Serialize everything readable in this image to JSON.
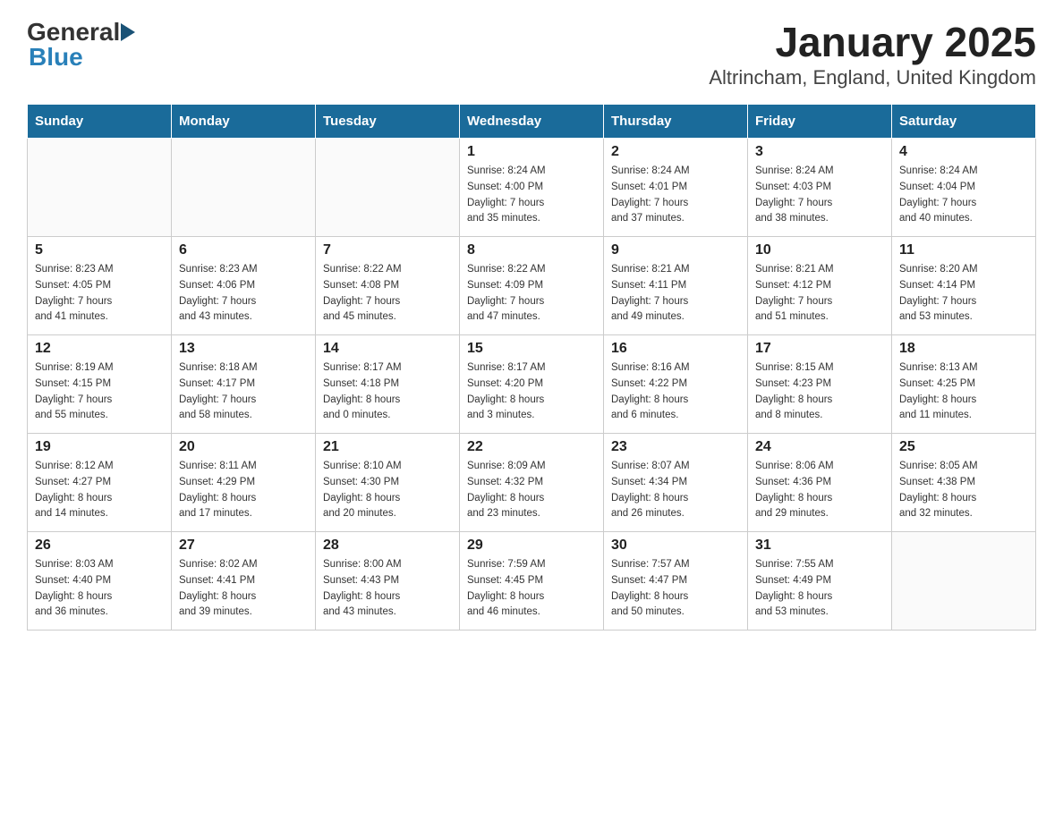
{
  "header": {
    "title": "January 2025",
    "subtitle": "Altrincham, England, United Kingdom",
    "logo_general": "General",
    "logo_blue": "Blue"
  },
  "calendar": {
    "days_of_week": [
      "Sunday",
      "Monday",
      "Tuesday",
      "Wednesday",
      "Thursday",
      "Friday",
      "Saturday"
    ],
    "weeks": [
      [
        {
          "day": "",
          "info": ""
        },
        {
          "day": "",
          "info": ""
        },
        {
          "day": "",
          "info": ""
        },
        {
          "day": "1",
          "info": "Sunrise: 8:24 AM\nSunset: 4:00 PM\nDaylight: 7 hours\nand 35 minutes."
        },
        {
          "day": "2",
          "info": "Sunrise: 8:24 AM\nSunset: 4:01 PM\nDaylight: 7 hours\nand 37 minutes."
        },
        {
          "day": "3",
          "info": "Sunrise: 8:24 AM\nSunset: 4:03 PM\nDaylight: 7 hours\nand 38 minutes."
        },
        {
          "day": "4",
          "info": "Sunrise: 8:24 AM\nSunset: 4:04 PM\nDaylight: 7 hours\nand 40 minutes."
        }
      ],
      [
        {
          "day": "5",
          "info": "Sunrise: 8:23 AM\nSunset: 4:05 PM\nDaylight: 7 hours\nand 41 minutes."
        },
        {
          "day": "6",
          "info": "Sunrise: 8:23 AM\nSunset: 4:06 PM\nDaylight: 7 hours\nand 43 minutes."
        },
        {
          "day": "7",
          "info": "Sunrise: 8:22 AM\nSunset: 4:08 PM\nDaylight: 7 hours\nand 45 minutes."
        },
        {
          "day": "8",
          "info": "Sunrise: 8:22 AM\nSunset: 4:09 PM\nDaylight: 7 hours\nand 47 minutes."
        },
        {
          "day": "9",
          "info": "Sunrise: 8:21 AM\nSunset: 4:11 PM\nDaylight: 7 hours\nand 49 minutes."
        },
        {
          "day": "10",
          "info": "Sunrise: 8:21 AM\nSunset: 4:12 PM\nDaylight: 7 hours\nand 51 minutes."
        },
        {
          "day": "11",
          "info": "Sunrise: 8:20 AM\nSunset: 4:14 PM\nDaylight: 7 hours\nand 53 minutes."
        }
      ],
      [
        {
          "day": "12",
          "info": "Sunrise: 8:19 AM\nSunset: 4:15 PM\nDaylight: 7 hours\nand 55 minutes."
        },
        {
          "day": "13",
          "info": "Sunrise: 8:18 AM\nSunset: 4:17 PM\nDaylight: 7 hours\nand 58 minutes."
        },
        {
          "day": "14",
          "info": "Sunrise: 8:17 AM\nSunset: 4:18 PM\nDaylight: 8 hours\nand 0 minutes."
        },
        {
          "day": "15",
          "info": "Sunrise: 8:17 AM\nSunset: 4:20 PM\nDaylight: 8 hours\nand 3 minutes."
        },
        {
          "day": "16",
          "info": "Sunrise: 8:16 AM\nSunset: 4:22 PM\nDaylight: 8 hours\nand 6 minutes."
        },
        {
          "day": "17",
          "info": "Sunrise: 8:15 AM\nSunset: 4:23 PM\nDaylight: 8 hours\nand 8 minutes."
        },
        {
          "day": "18",
          "info": "Sunrise: 8:13 AM\nSunset: 4:25 PM\nDaylight: 8 hours\nand 11 minutes."
        }
      ],
      [
        {
          "day": "19",
          "info": "Sunrise: 8:12 AM\nSunset: 4:27 PM\nDaylight: 8 hours\nand 14 minutes."
        },
        {
          "day": "20",
          "info": "Sunrise: 8:11 AM\nSunset: 4:29 PM\nDaylight: 8 hours\nand 17 minutes."
        },
        {
          "day": "21",
          "info": "Sunrise: 8:10 AM\nSunset: 4:30 PM\nDaylight: 8 hours\nand 20 minutes."
        },
        {
          "day": "22",
          "info": "Sunrise: 8:09 AM\nSunset: 4:32 PM\nDaylight: 8 hours\nand 23 minutes."
        },
        {
          "day": "23",
          "info": "Sunrise: 8:07 AM\nSunset: 4:34 PM\nDaylight: 8 hours\nand 26 minutes."
        },
        {
          "day": "24",
          "info": "Sunrise: 8:06 AM\nSunset: 4:36 PM\nDaylight: 8 hours\nand 29 minutes."
        },
        {
          "day": "25",
          "info": "Sunrise: 8:05 AM\nSunset: 4:38 PM\nDaylight: 8 hours\nand 32 minutes."
        }
      ],
      [
        {
          "day": "26",
          "info": "Sunrise: 8:03 AM\nSunset: 4:40 PM\nDaylight: 8 hours\nand 36 minutes."
        },
        {
          "day": "27",
          "info": "Sunrise: 8:02 AM\nSunset: 4:41 PM\nDaylight: 8 hours\nand 39 minutes."
        },
        {
          "day": "28",
          "info": "Sunrise: 8:00 AM\nSunset: 4:43 PM\nDaylight: 8 hours\nand 43 minutes."
        },
        {
          "day": "29",
          "info": "Sunrise: 7:59 AM\nSunset: 4:45 PM\nDaylight: 8 hours\nand 46 minutes."
        },
        {
          "day": "30",
          "info": "Sunrise: 7:57 AM\nSunset: 4:47 PM\nDaylight: 8 hours\nand 50 minutes."
        },
        {
          "day": "31",
          "info": "Sunrise: 7:55 AM\nSunset: 4:49 PM\nDaylight: 8 hours\nand 53 minutes."
        },
        {
          "day": "",
          "info": ""
        }
      ]
    ]
  }
}
